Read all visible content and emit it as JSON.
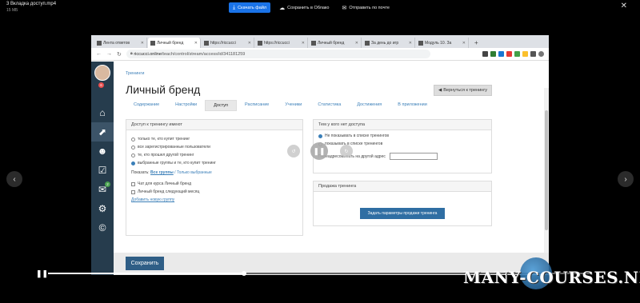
{
  "viewer": {
    "file_name": "3 Вкладка доступ.mp4",
    "file_size": "15 МБ",
    "actions": [
      {
        "label": "Скачать файл",
        "icon": "download-icon"
      },
      {
        "label": "Сохранить в Облако",
        "icon": "cloud-icon"
      },
      {
        "label": "Отправить по почте",
        "icon": "mail-icon"
      }
    ],
    "progress_fraction": 0.36,
    "watermark": "MANY-COURSES.NET"
  },
  "browser": {
    "tabs": [
      {
        "label": "Лента ответов"
      },
      {
        "label": "Личный бренд"
      },
      {
        "label": "https://riccucci"
      },
      {
        "label": "https://riccucci"
      },
      {
        "label": "Личный бренд"
      },
      {
        "label": "За день до игр"
      },
      {
        "label": "Модуль 10. За"
      }
    ],
    "url_domain": "riccucci.online",
    "url_path": "/teach/control/stream/access/id/341181259"
  },
  "page": {
    "breadcrumb": "Тренинги",
    "title": "Личный бренд",
    "back_button": "Вернуться к тренингу",
    "tabs": [
      "Содержание",
      "Настройки",
      "Доступ",
      "Расписание",
      "Ученики",
      "Статистика",
      "Достижения",
      "В приложении"
    ],
    "active_tab": "Доступ",
    "access_panel": {
      "heading": "Доступ к тренингу имеют",
      "options": [
        "только те, кто купит тренинг",
        "все зарегистрированные пользователи",
        "те, кто прошел другой тренинг",
        "выбранные группы и те, кто купит тренинг"
      ],
      "show_label": "Показать:",
      "show_all": "Все группы",
      "show_sep": " / ",
      "show_selected": "Только выбранные",
      "groups": [
        "Чат для курса Личный бренд",
        "Личный бренд следующий месяц"
      ],
      "add_group": "Добавить новую группу"
    },
    "no_access_panel": {
      "heading": "Тем у кого нет доступа",
      "option1": "Не показывать в списке тренингов",
      "option2": "показывать в списке тренингов",
      "redirect_label": "Переадресовывать на другой адрес"
    },
    "sale_panel": {
      "heading": "Продажа тренинга",
      "button": "Задать параметры продажи тренинга"
    },
    "save_button": "Сохранить"
  },
  "colors": {
    "accent": "#1a73e8",
    "link": "#3b7fb8",
    "sidebar": "#263c4d",
    "save": "#2f5e86"
  }
}
